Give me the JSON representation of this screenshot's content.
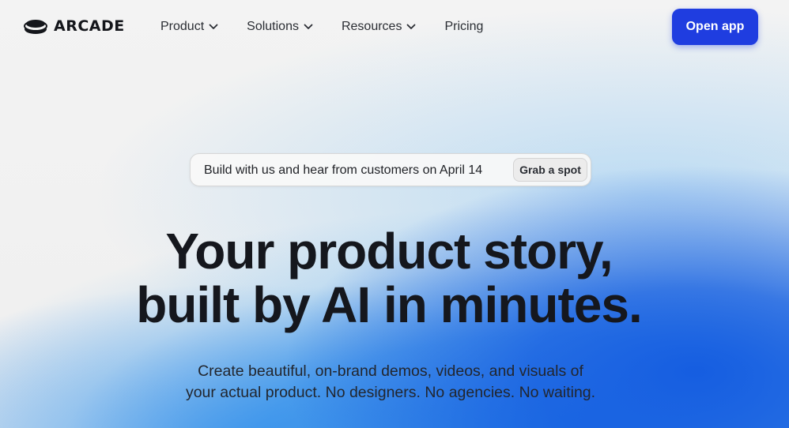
{
  "brand": {
    "name": "ARCADE",
    "logo_icon": "stacked-disc-logo"
  },
  "nav": {
    "items": [
      {
        "label": "Product",
        "has_dropdown": true
      },
      {
        "label": "Solutions",
        "has_dropdown": true
      },
      {
        "label": "Resources",
        "has_dropdown": true
      },
      {
        "label": "Pricing",
        "has_dropdown": false
      }
    ],
    "cta_label": "Open app"
  },
  "announcement": {
    "text": "Build with us and hear from customers on April 14",
    "button_label": "Grab a spot"
  },
  "hero": {
    "title_line1": "Your product story,",
    "title_line2": "built by AI in minutes.",
    "subtitle_line1": "Create beautiful, on-brand demos, videos, and visuals of",
    "subtitle_line2": "your actual product. No designers. No agencies. No waiting."
  },
  "colors": {
    "accent": "#1f3de0",
    "text": "#15171d",
    "background": "#f1f1f1",
    "gradient_blue": "#125ae0"
  }
}
